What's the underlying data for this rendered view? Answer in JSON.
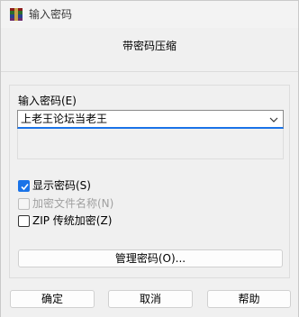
{
  "window": {
    "title": "输入密码",
    "subtitle": "带密码压缩"
  },
  "password": {
    "label": "输入密码(E)",
    "value": "上老王论坛当老王"
  },
  "options": {
    "show_password": {
      "label": "显示密码(S)",
      "checked": true
    },
    "encrypt_filenames": {
      "label": "加密文件名称(N)",
      "checked": false,
      "disabled": true
    },
    "zip_legacy": {
      "label": "ZIP 传统加密(Z)",
      "checked": false
    }
  },
  "buttons": {
    "manage": "管理密码(O)...",
    "ok": "确定",
    "cancel": "取消",
    "help": "帮助"
  },
  "colors": {
    "accent": "#1a73e8",
    "background": "#f0f0f0"
  }
}
